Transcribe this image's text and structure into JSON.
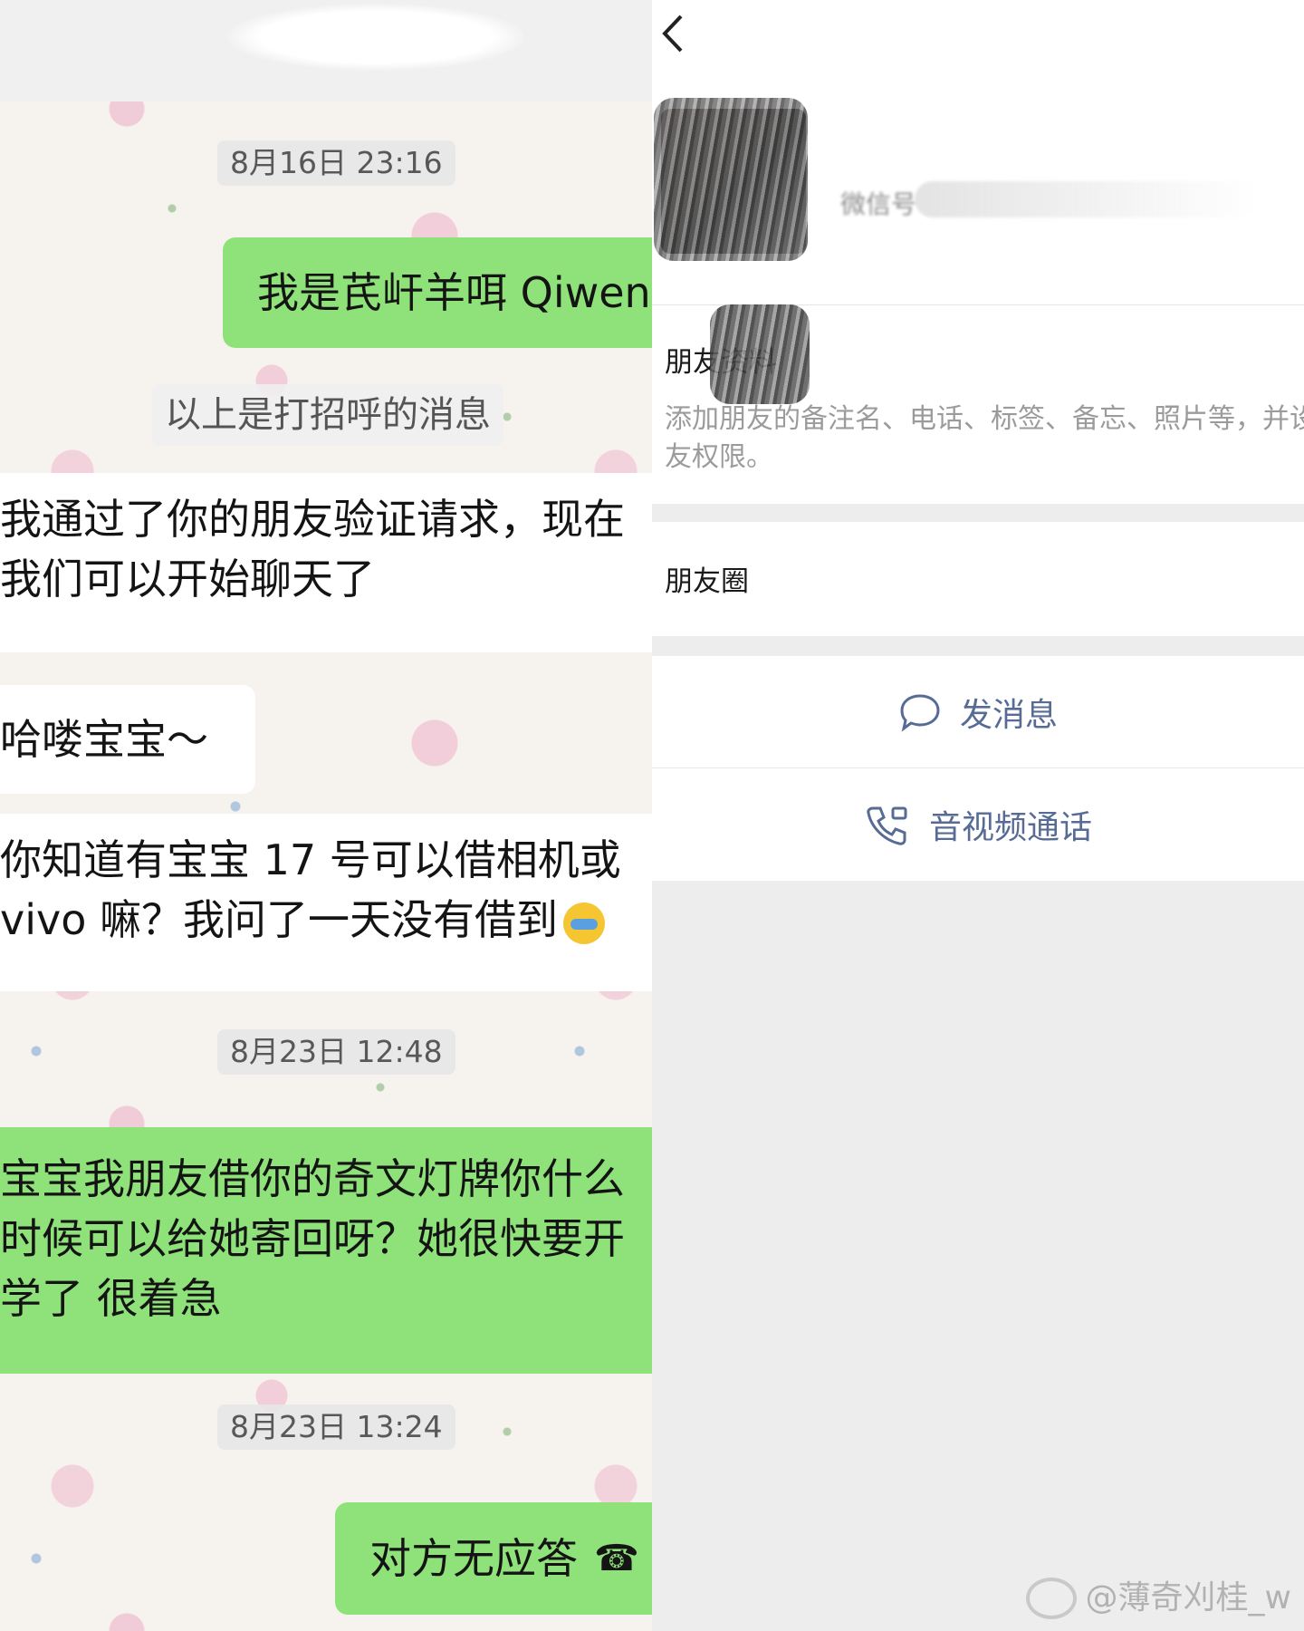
{
  "chat": {
    "timestamp_1": "8月16日 23:16",
    "greeting_bubble": "我是芪屽羊咡 Qiwen",
    "greeting_note": "以上是打招呼的消息",
    "system_message_line1": "我通过了你的朋友验证请求，现在",
    "system_message_line2": "我们可以开始聊天了",
    "msg_hello": "哈喽宝宝～",
    "msg_question_line1": "你知道有宝宝 17 号可以借相机或",
    "msg_question_line2": "vivo 嘛？我问了一天没有借到",
    "timestamp_2": "8月23日 12:48",
    "msg_return_line1": "宝宝我朋友借你的奇文灯牌你什么",
    "msg_return_line2": "时候可以给她寄回呀？她很快要开",
    "msg_return_line3": "学了 很着急",
    "timestamp_3": "8月23日 13:24",
    "msg_call": "对方无应答"
  },
  "profile": {
    "back_icon": "chevron-left-icon",
    "wechat_id_label": "微信号",
    "friend_info_label": "朋友资料",
    "friend_info_hint_line1": "添加朋友的备注名、电话、标签、备忘、照片等，并设置朋",
    "friend_info_hint_line2": "友权限。",
    "moments_label": "朋友圈",
    "send_message_label": "发消息",
    "av_call_label": "音视频通话",
    "colors": {
      "link_blue": "#576b95",
      "chat_green": "#8fe17a",
      "page_gray": "#ededed"
    }
  },
  "watermark": "@薄奇刈桂_w"
}
